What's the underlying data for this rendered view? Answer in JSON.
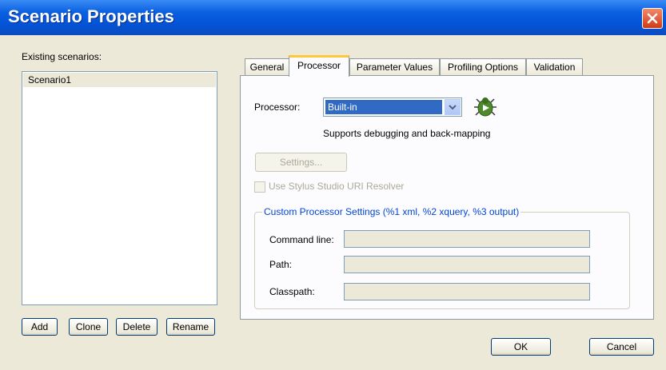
{
  "window": {
    "title": "Scenario Properties"
  },
  "left": {
    "label": "Existing scenarios:",
    "items": [
      "Scenario1"
    ],
    "buttons": {
      "add": "Add",
      "clone": "Clone",
      "delete": "Delete",
      "rename": "Rename"
    }
  },
  "tabs": [
    "General",
    "Processor",
    "Parameter Values",
    "Profiling Options",
    "Validation"
  ],
  "active_tab": "Processor",
  "processor": {
    "label": "Processor:",
    "selected": "Built-in",
    "description": "Supports debugging and back-mapping",
    "settings_button": "Settings...",
    "uri_resolver_label": "Use Stylus Studio URI Resolver",
    "uri_resolver_checked": false
  },
  "custom": {
    "legend": "Custom Processor Settings (%1 xml, %2 xquery, %3 output)",
    "command_line_label": "Command line:",
    "path_label": "Path:",
    "classpath_label": "Classpath:",
    "command_line_value": "",
    "path_value": "",
    "classpath_value": ""
  },
  "footer": {
    "ok": "OK",
    "cancel": "Cancel"
  },
  "icons": {
    "close": "close-icon",
    "dropdown": "chevron-down-icon",
    "debug": "bug-play-icon"
  }
}
